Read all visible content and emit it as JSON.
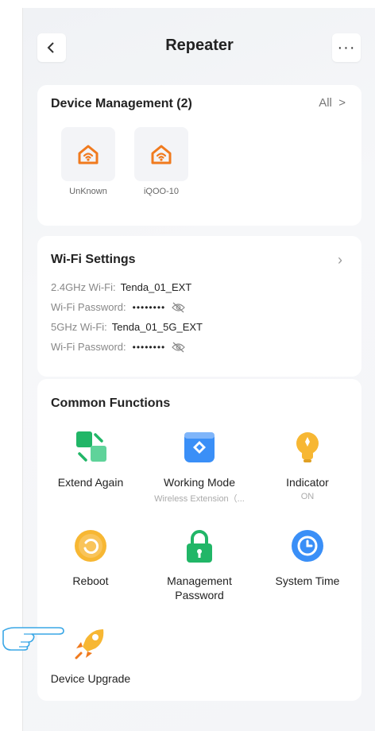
{
  "header": {
    "title": "Repeater",
    "back_icon": "chevron-left-icon",
    "more_label": "···"
  },
  "device_management": {
    "title": "Device Management (2)",
    "all_label": "All",
    "devices": [
      {
        "name": "UnKnown",
        "icon": "home-wifi-icon"
      },
      {
        "name": "iQOO-10",
        "icon": "home-wifi-icon"
      }
    ]
  },
  "wifi_settings": {
    "title": "Wi-Fi Settings",
    "rows": [
      {
        "label": "2.4GHz Wi-Fi:",
        "value": "Tenda_01_EXT"
      },
      {
        "label": "Wi-Fi Password:",
        "value": "••••••••"
      },
      {
        "label": "5GHz Wi-Fi:",
        "value": "Tenda_01_5G_EXT"
      },
      {
        "label": "Wi-Fi Password:",
        "value": "••••••••"
      }
    ]
  },
  "common_functions": {
    "title": "Common Functions",
    "items": [
      {
        "label": "Extend Again",
        "sub": ""
      },
      {
        "label": "Working Mode",
        "sub": "Wireless Extension（..."
      },
      {
        "label": "Indicator",
        "sub": "ON"
      },
      {
        "label": "Reboot",
        "sub": ""
      },
      {
        "label": "Management Password",
        "sub": ""
      },
      {
        "label": "System Time",
        "sub": ""
      },
      {
        "label": "Device Upgrade",
        "sub": ""
      }
    ]
  },
  "colors": {
    "accent_orange": "#f07a1e",
    "green": "#21b667",
    "blue": "#3a8ff7",
    "yellow": "#f7b733"
  }
}
